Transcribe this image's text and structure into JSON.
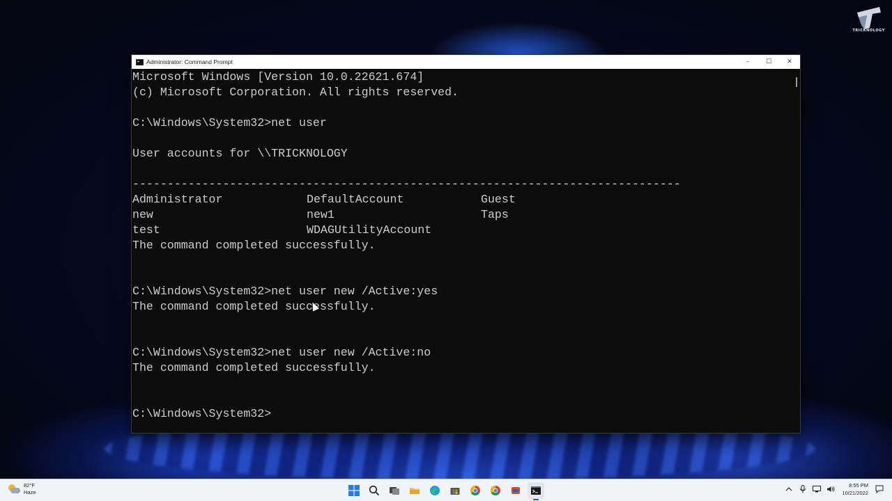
{
  "window": {
    "title": "Administrator: Command Prompt",
    "minimize_glyph": "–",
    "maximize_glyph": "☐",
    "close_glyph": "✕"
  },
  "console": {
    "lines": [
      "Microsoft Windows [Version 10.0.22621.674]",
      "(c) Microsoft Corporation. All rights reserved.",
      "",
      "C:\\Windows\\System32>net user",
      "",
      "User accounts for \\\\TRICKNOLOGY",
      "",
      "-------------------------------------------------------------------------------"
    ],
    "accounts": [
      [
        "Administrator",
        "DefaultAccount",
        "Guest"
      ],
      [
        "new",
        "new1",
        "Taps"
      ],
      [
        "test",
        "WDAGUtilityAccount",
        ""
      ]
    ],
    "lines_after": [
      "The command completed successfully.",
      "",
      "",
      "C:\\Windows\\System32>net user new /Active:yes",
      "The command completed successfully.",
      "",
      "",
      "C:\\Windows\\System32>net user new /Active:no",
      "The command completed successfully.",
      "",
      "",
      "C:\\Windows\\System32>"
    ]
  },
  "watermark": {
    "text": "TRICKNOLOGY"
  },
  "taskbar": {
    "weather_temp": "82°F",
    "weather_cond": "Haze",
    "weather_icon": "partly-cloudy-icon",
    "apps": [
      "start-icon",
      "search-icon",
      "task-view-icon",
      "file-explorer-icon",
      "edge-icon",
      "store-icon",
      "chrome-icon",
      "chrome-icon",
      "app-icon",
      "terminal-icon"
    ],
    "time": "8:55 PM",
    "date": "10/21/2022"
  },
  "colors": {
    "console_bg": "#0c0c0c",
    "console_fg": "#cccccc",
    "taskbar_bg": "#f2f3f7",
    "accent": "#0a5fd1"
  }
}
